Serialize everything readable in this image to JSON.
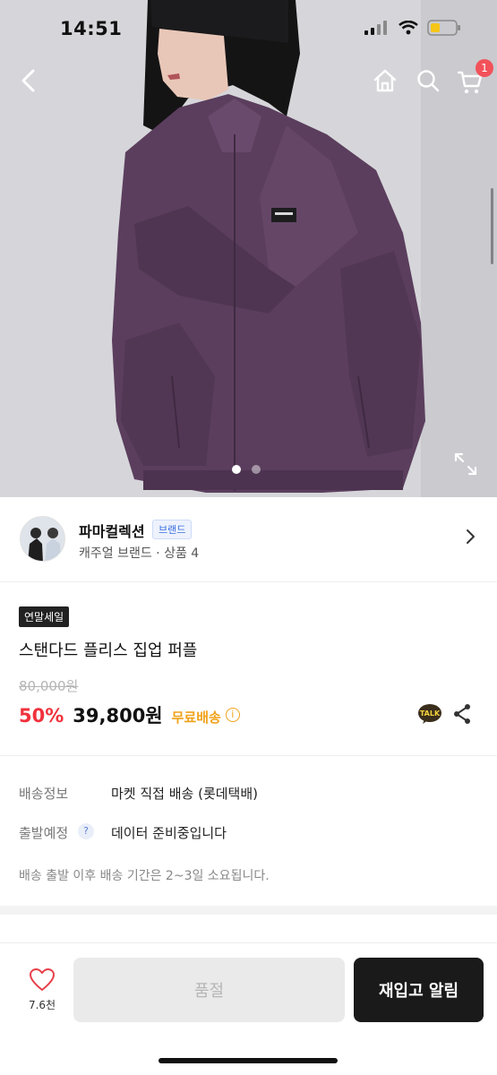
{
  "status_bar": {
    "time": "14:51"
  },
  "header": {
    "back_icon": "chevron-left-icon",
    "home_icon": "home-icon",
    "search_icon": "search-icon",
    "cart_icon": "cart-icon",
    "cart_count": "1"
  },
  "gallery": {
    "page_count": 2,
    "active_index": 0,
    "expand_icon": "expand-icon"
  },
  "seller": {
    "name": "파마컬렉션",
    "badge": "브랜드",
    "meta": "캐주얼 브랜드 · 상품 4"
  },
  "product": {
    "tag": "연말세일",
    "title": "스탠다드 플리스 집업 퍼플",
    "original_price": "80,000원",
    "discount": "50%",
    "price": "39,800원",
    "free_shipping": "무료배송",
    "talk_label": "TALK"
  },
  "delivery": {
    "info_label": "배송정보",
    "info_value": "마켓 직접 배송 (롯데택배)",
    "schedule_label": "출발예정",
    "schedule_value": "데이터 준비중입니다",
    "help_glyph": "?",
    "note": "배송 출발 이후 배송 기간은 2~3일 소요됩니다."
  },
  "bottom_bar": {
    "like_count": "7.6천",
    "soldout_label": "품절",
    "restock_label": "재입고 알림"
  },
  "colors": {
    "accent_red": "#f0323c",
    "free_ship": "#f0a21a",
    "brand_blue": "#3b6fe0"
  }
}
